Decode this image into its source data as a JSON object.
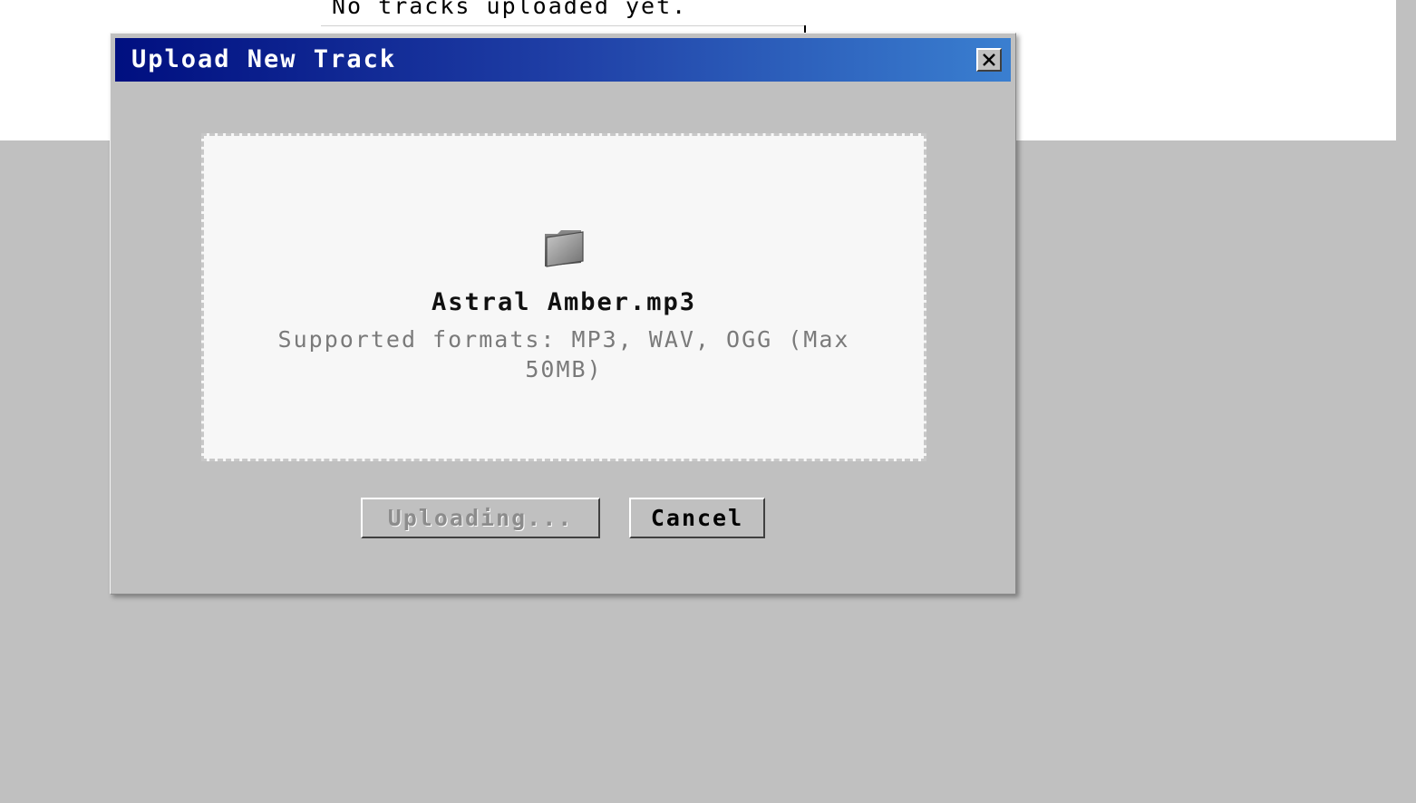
{
  "background": {
    "empty_message": "No tracks uploaded yet."
  },
  "dialog": {
    "title": "Upload New Track",
    "close_icon": "close-icon",
    "dropzone": {
      "icon": "folder-icon",
      "file_name": "Astral Amber.mp3",
      "formats_text": "Supported formats: MP3, WAV, OGG (Max 50MB)"
    },
    "buttons": {
      "upload_label": "Uploading...",
      "cancel_label": "Cancel"
    }
  },
  "colors": {
    "desktop": "#c0c0c0",
    "titlebar_start": "#000f80",
    "titlebar_end": "#3a7fd0",
    "dropzone_bg": "#f7f7f7",
    "disabled_text": "#8c8c8c"
  }
}
